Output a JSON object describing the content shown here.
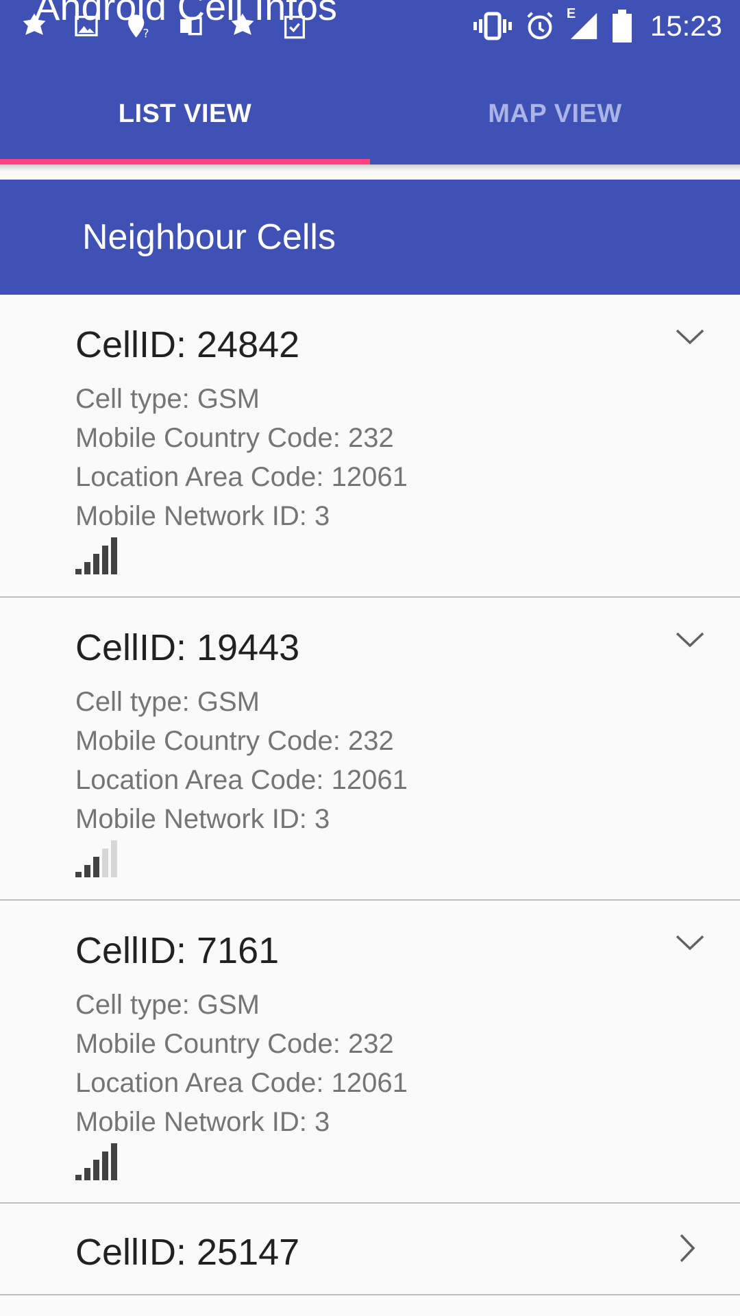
{
  "app": {
    "title": "Android Cell Infos"
  },
  "status_bar": {
    "notification_icons": [
      "app-icon",
      "image-icon",
      "location-unknown-icon",
      "outlook-icon",
      "app-icon-2",
      "clipboard-check-icon"
    ],
    "network_type": "E",
    "time": "15:23",
    "icons": [
      "vibrate-icon",
      "alarm-icon",
      "signal-icon",
      "battery-icon"
    ]
  },
  "tabs": [
    {
      "label": "LIST VIEW",
      "active": true
    },
    {
      "label": "MAP VIEW",
      "active": false
    }
  ],
  "section": {
    "title": "Neighbour Cells"
  },
  "cells": [
    {
      "title": "CellID: 24842",
      "expanded": true,
      "cell_type": "Cell type: GSM",
      "mcc": "Mobile Country Code: 232",
      "lac": "Location Area Code: 12061",
      "mnc": "Mobile Network ID: 3",
      "signal_level": 4
    },
    {
      "title": "CellID: 19443",
      "expanded": true,
      "cell_type": "Cell type: GSM",
      "mcc": "Mobile Country Code: 232",
      "lac": "Location Area Code: 12061",
      "mnc": "Mobile Network ID: 3",
      "signal_level": 2
    },
    {
      "title": "CellID: 7161",
      "expanded": true,
      "cell_type": "Cell type: GSM",
      "mcc": "Mobile Country Code: 232",
      "lac": "Location Area Code: 12061",
      "mnc": "Mobile Network ID: 3",
      "signal_level": 4
    },
    {
      "title": "CellID: 25147",
      "expanded": false
    }
  ],
  "colors": {
    "primary": "#3f51b5",
    "accent": "#ff4081",
    "signal_on": "#424242",
    "signal_off": "#d6d6d6"
  }
}
